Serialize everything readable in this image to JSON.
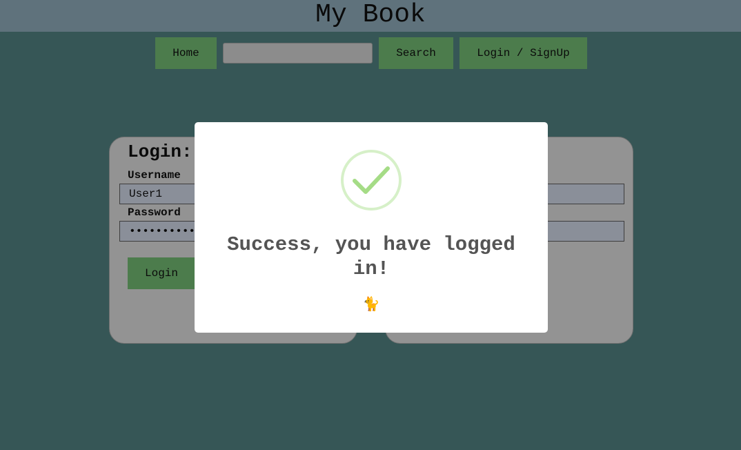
{
  "header": {
    "title": "My Book"
  },
  "nav": {
    "home_label": "Home",
    "search_value": "",
    "search_label": "Search",
    "login_signup_label": "Login / SignUp"
  },
  "login_panel": {
    "title": "Login:",
    "username_label": "Username",
    "username_value": "User1",
    "password_label": "Password",
    "password_value": "••••••••••",
    "login_button": "Login"
  },
  "modal": {
    "title": "Success, you have logged in!",
    "emoji": "🐈",
    "icon": "checkmark-icon",
    "accent_color": "#a5dc86"
  }
}
